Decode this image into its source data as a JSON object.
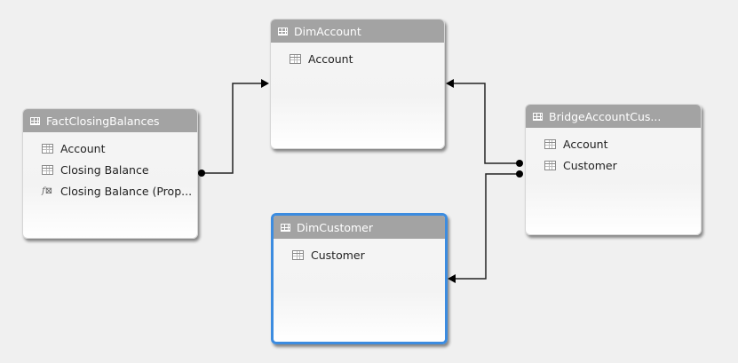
{
  "tables": {
    "fact": {
      "title": "FactClosingBalances",
      "columns": [
        "Account",
        "Closing Balance",
        "Closing Balance (Prop..."
      ]
    },
    "dim_account": {
      "title": "DimAccount",
      "columns": [
        "Account"
      ]
    },
    "bridge": {
      "title": "BridgeAccountCus...",
      "columns": [
        "Account",
        "Customer"
      ]
    },
    "dim_customer": {
      "title": "DimCustomer",
      "columns": [
        "Customer"
      ]
    }
  },
  "selected_color": "#3c8ce0"
}
